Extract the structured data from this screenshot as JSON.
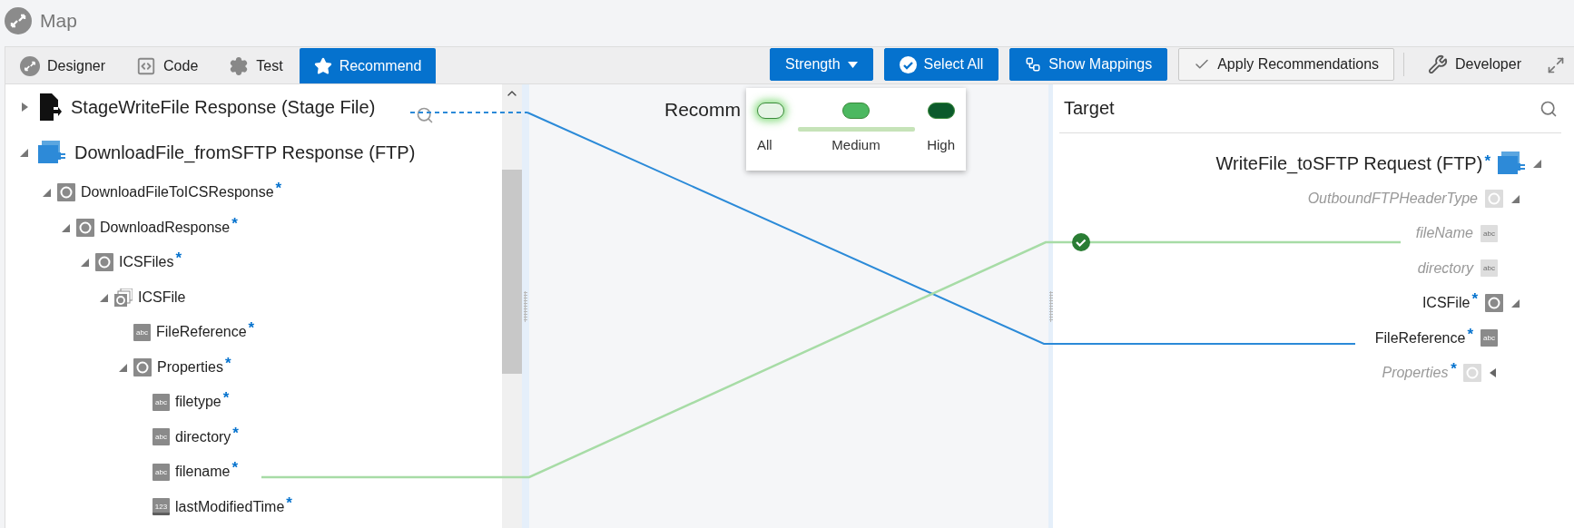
{
  "header": {
    "title": "Map"
  },
  "tabs": [
    {
      "label": "Designer",
      "selected": false
    },
    {
      "label": "Code",
      "selected": false
    },
    {
      "label": "Test",
      "selected": false
    },
    {
      "label": "Recommend",
      "selected": true
    }
  ],
  "actions": [
    {
      "label": "Strength",
      "kind": "dropdown"
    },
    {
      "label": "Select All",
      "kind": "primary"
    },
    {
      "label": "Show Mappings",
      "kind": "primary"
    },
    {
      "label": "Apply Recommendations",
      "kind": "secondary"
    },
    {
      "label": "Developer",
      "kind": "plain"
    }
  ],
  "strength_popup": {
    "options": [
      {
        "label": "All",
        "selected": true,
        "color": "#e6f4e6"
      },
      {
        "label": "Medium",
        "selected": false,
        "color": "#4cb860"
      },
      {
        "label": "High",
        "selected": false,
        "color": "#0b5a2b"
      }
    ]
  },
  "source": {
    "tree": [
      {
        "label": "StageWriteFile Response (Stage File)",
        "kind": "file",
        "expanded": false
      },
      {
        "label": "DownloadFile_fromSFTP Response (FTP)",
        "kind": "ftp",
        "expanded": true,
        "children": [
          {
            "label": "DownloadFileToICSResponse",
            "kind": "complex",
            "mark": "*",
            "expanded": true,
            "children": [
              {
                "label": "DownloadResponse",
                "kind": "complex",
                "mark": "*",
                "expanded": true,
                "children": [
                  {
                    "label": "ICSFiles",
                    "kind": "complex",
                    "mark": "*",
                    "expanded": true,
                    "children": [
                      {
                        "label": "ICSFile",
                        "kind": "repeating",
                        "expanded": true,
                        "children": [
                          {
                            "label": "FileReference",
                            "kind": "string",
                            "badge": "abc",
                            "mark": "*"
                          },
                          {
                            "label": "Properties",
                            "kind": "complex",
                            "mark": "*",
                            "expanded": true,
                            "children": [
                              {
                                "label": "filetype",
                                "kind": "string",
                                "badge": "abc",
                                "mark": "*"
                              },
                              {
                                "label": "directory",
                                "kind": "string",
                                "badge": "abc",
                                "mark": "*"
                              },
                              {
                                "label": "filename",
                                "kind": "string",
                                "badge": "abc",
                                "mark": "*"
                              },
                              {
                                "label": "lastModifiedTime",
                                "kind": "number",
                                "badge": "123",
                                "mark": "*"
                              }
                            ]
                          }
                        ]
                      }
                    ]
                  }
                ]
              }
            ]
          }
        ]
      }
    ]
  },
  "recommendations": {
    "title": "Recomm"
  },
  "target": {
    "title": "Target",
    "tree": [
      {
        "label": "WriteFile_toSFTP Request (FTP)",
        "kind": "ftp",
        "mark": "*",
        "dimmed": false,
        "expanded": true,
        "children": [
          {
            "label": "OutboundFTPHeaderType",
            "kind": "complex",
            "dimmed": true,
            "expanded": true,
            "children": [
              {
                "label": "fileName",
                "kind": "string",
                "badge": "abc",
                "dimmed": true
              },
              {
                "label": "directory",
                "kind": "string",
                "badge": "abc",
                "dimmed": true
              }
            ]
          },
          {
            "label": "ICSFile",
            "kind": "complex",
            "mark": "*",
            "dimmed": false,
            "expanded": true,
            "children": [
              {
                "label": "FileReference",
                "kind": "string",
                "badge": "abc",
                "mark": "*",
                "dimmed": false
              },
              {
                "label": "Properties",
                "kind": "complex",
                "mark": "*",
                "dimmed": true,
                "expanded": false
              }
            ]
          }
        ]
      }
    ]
  }
}
